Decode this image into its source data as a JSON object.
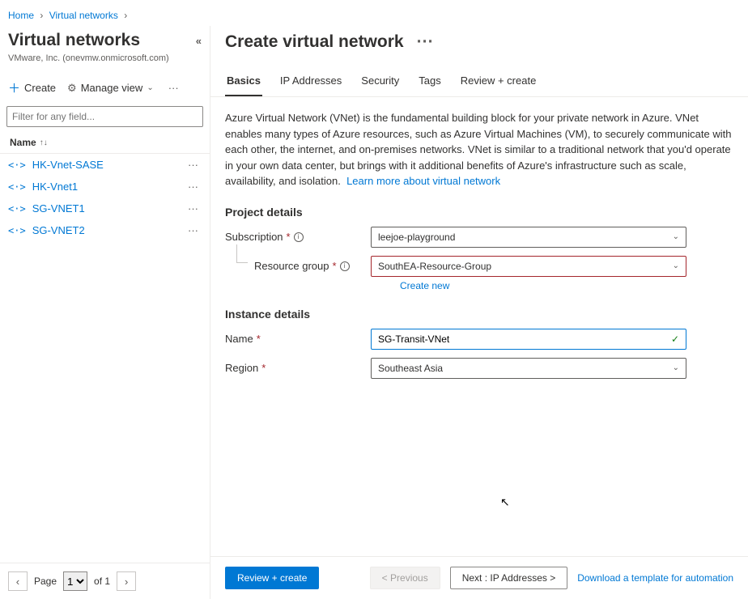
{
  "breadcrumb": {
    "home": "Home",
    "vnets": "Virtual networks"
  },
  "sidebar": {
    "title": "Virtual networks",
    "subtitle": "VMware, Inc. (onevmw.onmicrosoft.com)",
    "create": "Create",
    "manage_view": "Manage view",
    "filter_placeholder": "Filter for any field...",
    "col_name": "Name",
    "items": [
      {
        "name": "HK-Vnet-SASE"
      },
      {
        "name": "HK-Vnet1"
      },
      {
        "name": "SG-VNET1"
      },
      {
        "name": "SG-VNET2"
      }
    ],
    "pager": {
      "page_label": "Page",
      "current": "1",
      "total": "of 1"
    }
  },
  "main": {
    "title": "Create virtual network",
    "tabs": [
      {
        "label": "Basics",
        "active": true
      },
      {
        "label": "IP Addresses"
      },
      {
        "label": "Security"
      },
      {
        "label": "Tags"
      },
      {
        "label": "Review + create"
      }
    ],
    "desc": "Azure Virtual Network (VNet) is the fundamental building block for your private network in Azure. VNet enables many types of Azure resources, such as Azure Virtual Machines (VM), to securely communicate with each other, the internet, and on-premises networks. VNet is similar to a traditional network that you'd operate in your own data center, but brings with it additional benefits of Azure's infrastructure such as scale, availability, and isolation.",
    "desc_link": "Learn more about virtual network",
    "sect_project": "Project details",
    "sect_instance": "Instance details",
    "fields": {
      "subscription_label": "Subscription",
      "subscription_value": "leejoe-playground",
      "rg_label": "Resource group",
      "rg_value": "SouthEA-Resource-Group",
      "create_new": "Create new",
      "name_label": "Name",
      "name_value": "SG-Transit-VNet",
      "region_label": "Region",
      "region_value": "Southeast Asia"
    }
  },
  "footer": {
    "review": "Review + create",
    "prev": "< Previous",
    "next": "Next : IP Addresses >",
    "download": "Download a template for automation"
  }
}
